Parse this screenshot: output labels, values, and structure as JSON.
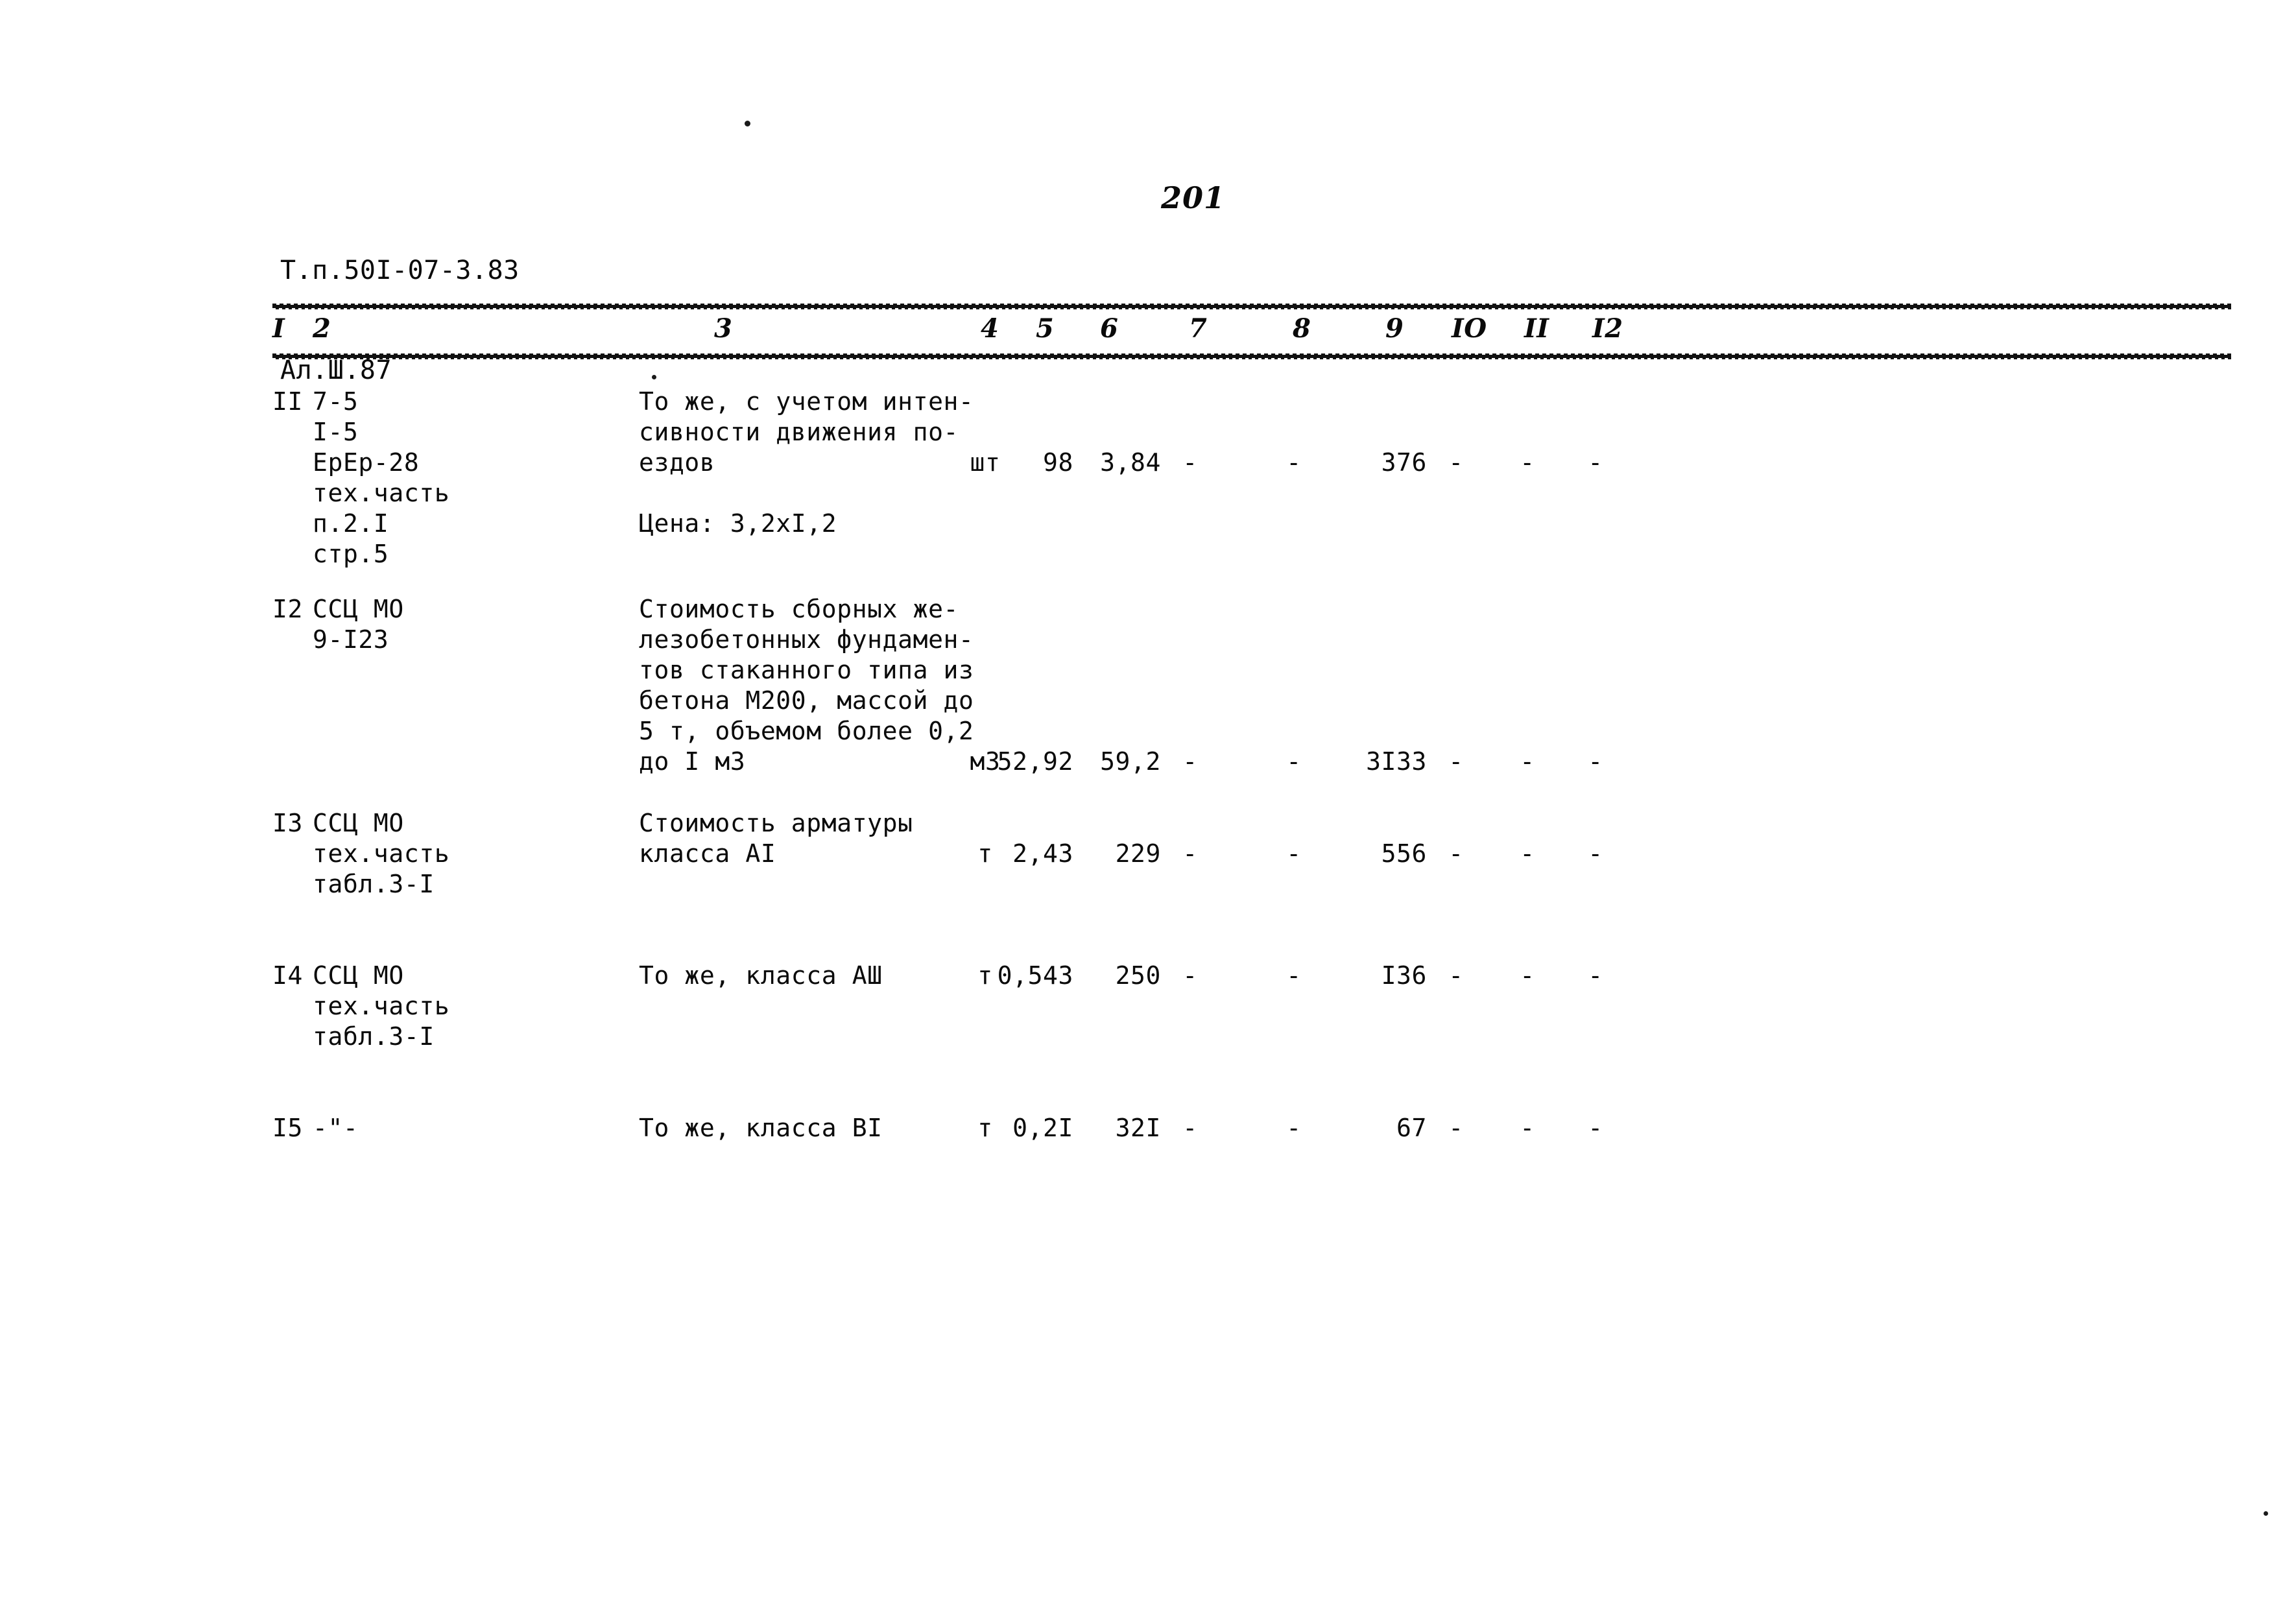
{
  "document": {
    "header_lines": [
      "Т.п.50I-07-3.83",
      "Ал.Ш.87"
    ],
    "page_number": "201"
  },
  "table": {
    "column_headers": [
      "I",
      "2",
      "3",
      "4",
      "5",
      "6",
      "7",
      "8",
      "9",
      "IO",
      "II",
      "I2"
    ],
    "rows": [
      {
        "c1": "II",
        "c2": "7-5\nI-5\nЕрЕр-28\nтех.часть\nп.2.I\nстр.5",
        "c3": "То же, с учетом интен-\nсивности движения по-\nездов\n\nЦена: 3,2хI,2",
        "c4": "шт",
        "c5": "98",
        "c6": "3,84",
        "c7": "-",
        "c8": "-",
        "c9": "376",
        "c10": "-",
        "c11": "-",
        "c12": "-"
      },
      {
        "c1": "I2",
        "c2": "ССЦ МО\n9-I23",
        "c3": "Стоимость сборных же-\nлезобетонных фундамен-\nтов стаканного типа из\nбетона М200, массой до\n5 т, объемом более 0,2\nдо I м3",
        "c4": "м3",
        "c5": "52,92",
        "c6": "59,2",
        "c7": "-",
        "c8": "-",
        "c9": "3I33",
        "c10": "-",
        "c11": "-",
        "c12": "-"
      },
      {
        "c1": "I3",
        "c2": "ССЦ МО\nтех.часть\nтабл.3-I",
        "c3": "Стоимость арматуры\nкласса АI",
        "c4": "т",
        "c5": "2,43",
        "c6": "229",
        "c7": "-",
        "c8": "-",
        "c9": "556",
        "c10": "-",
        "c11": "-",
        "c12": "-"
      },
      {
        "c1": "I4",
        "c2": "ССЦ МО\nтех.часть\nтабл.3-I",
        "c3": "То же, класса АШ",
        "c4": "т",
        "c5": "0,543",
        "c6": "250",
        "c7": "-",
        "c8": "-",
        "c9": "I36",
        "c10": "-",
        "c11": "-",
        "c12": "-"
      },
      {
        "c1": "I5",
        "c2": "-\"-",
        "c3": "То же, класса ВI",
        "c4": "т",
        "c5": "0,2I",
        "c6": "32I",
        "c7": "-",
        "c8": "-",
        "c9": "67",
        "c10": "-",
        "c11": "-",
        "c12": "-"
      }
    ]
  }
}
